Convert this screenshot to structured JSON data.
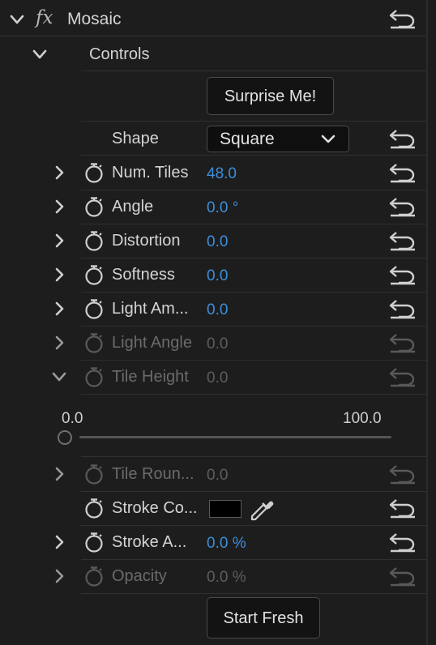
{
  "effect": {
    "name": "Mosaic",
    "fx_symbol": "fx",
    "controls_label": "Controls"
  },
  "buttons": {
    "surprise": "Surprise Me!",
    "start_fresh": "Start Fresh"
  },
  "shape": {
    "label": "Shape",
    "value": "Square"
  },
  "params": [
    {
      "label": "Num. Tiles",
      "value": "48.0",
      "enabled": true
    },
    {
      "label": "Angle",
      "value": "0.0 °",
      "enabled": true
    },
    {
      "label": "Distortion",
      "value": "0.0",
      "enabled": true
    },
    {
      "label": "Softness",
      "value": "0.0",
      "enabled": true
    },
    {
      "label": "Light Am...",
      "value": "0.0",
      "enabled": true
    },
    {
      "label": "Light Angle",
      "value": "0.0",
      "enabled": false
    },
    {
      "label": "Tile Height",
      "value": "0.0",
      "enabled": false,
      "expanded": true
    },
    {
      "label": "Tile Roun...",
      "value": "0.0",
      "enabled": false
    },
    {
      "label": "Stroke Co...",
      "value": "",
      "enabled": true,
      "type": "color",
      "color": "#000000"
    },
    {
      "label": "Stroke A...",
      "value": "0.0 %",
      "enabled": true
    },
    {
      "label": "Opacity",
      "value": "0.0 %",
      "enabled": false
    }
  ],
  "tile_height_slider": {
    "min_label": "0.0",
    "max_label": "100.0",
    "value": 0
  },
  "colors": {
    "value_blue": "#3c8fdc",
    "background": "#1d1d1d"
  },
  "icons": {
    "reset": "reset-arrow-icon",
    "stopwatch": "stopwatch-icon",
    "eyedropper": "eyedropper-icon",
    "chevron_right": "chevron-right-icon",
    "chevron_down": "chevron-down-icon"
  }
}
